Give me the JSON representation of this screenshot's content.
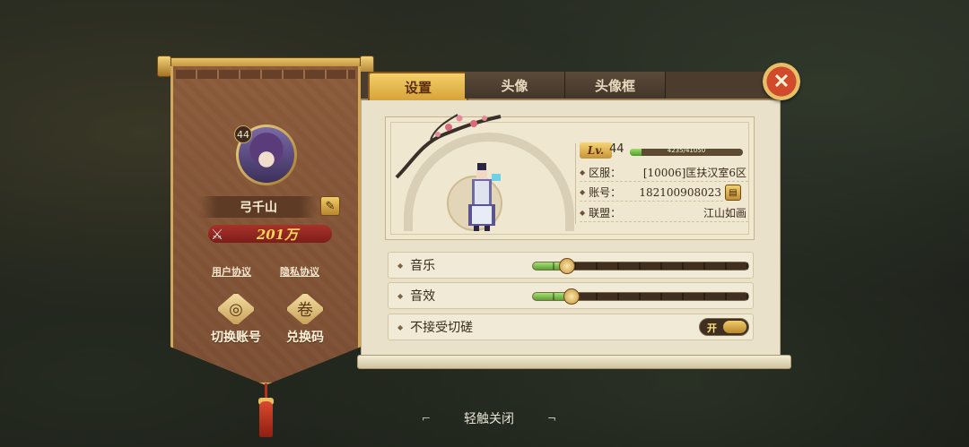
{
  "profile": {
    "level": "44",
    "name": "弓千山",
    "power": "201万",
    "links": {
      "user_agreement": "用户协议",
      "privacy_policy": "隐私协议"
    },
    "actions": {
      "switch_account": "切换账号",
      "redeem_code": "兑换码"
    }
  },
  "tabs": [
    {
      "label": "设置",
      "active": true
    },
    {
      "label": "头像",
      "active": false
    },
    {
      "label": "头像框",
      "active": false
    }
  ],
  "info": {
    "lv_label": "Lv.",
    "level": "44",
    "xp_text": "4235/41050",
    "xp_fraction": 0.1,
    "server_key": "区服：",
    "server_val": "[10006]匡扶汉室6区",
    "account_key": "账号：",
    "account_val": "182100908023",
    "alliance_key": "联盟：",
    "alliance_val": "江山如画"
  },
  "settings": {
    "music": {
      "label": "音乐",
      "value": 0.16
    },
    "sound": {
      "label": "音效",
      "value": 0.18
    },
    "no_duel": {
      "label": "不接受切磋",
      "toggle_label": "开",
      "on": true
    }
  },
  "footer": {
    "tap_close": "轻触关闭"
  },
  "colors": {
    "accent_gold": "#d7a33a",
    "banner_brown": "#7b4e33",
    "power_red": "#a8322a",
    "slider_green": "#5aa032"
  }
}
